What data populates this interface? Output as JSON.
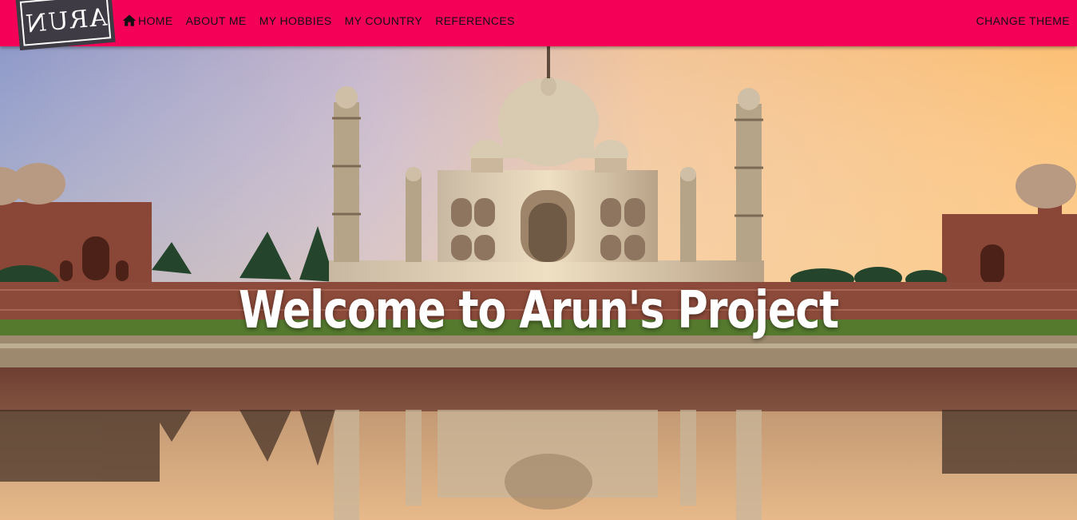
{
  "header": {
    "logo_text": "ARUN",
    "nav": [
      {
        "label": "HOME",
        "icon": "home-icon"
      },
      {
        "label": "ABOUT ME"
      },
      {
        "label": "MY HOBBIES"
      },
      {
        "label": "MY COUNTRY"
      },
      {
        "label": "REFERENCES"
      }
    ],
    "theme_button": "CHANGE THEME"
  },
  "hero": {
    "title": "Welcome to Arun's Project",
    "image": "taj-mahal-sunset-reflection"
  },
  "colors": {
    "accent": "#f50057",
    "nav_text": "#111111",
    "title_text": "#ffffff"
  }
}
